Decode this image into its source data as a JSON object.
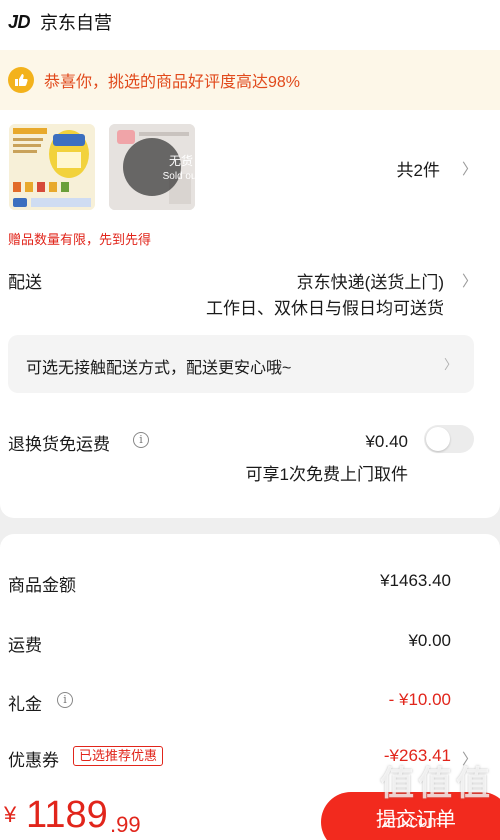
{
  "shop": {
    "logo": "JD",
    "name": "京东自营"
  },
  "banner": {
    "text": "恭喜你，挑选的商品好评度高达98%",
    "icon": "thumbs-up-icon"
  },
  "products": {
    "sold_out_cn": "无货",
    "sold_out_en": "Sold out",
    "count_text": "共2件",
    "gift_note": "赠品数量有限，先到先得"
  },
  "delivery": {
    "label": "配送",
    "method": "京东快递(送货上门)",
    "schedule": "工作日、双休日与假日均可送货",
    "contactless": "可选无接触配送方式，配送更安心哦~"
  },
  "return_shipping": {
    "label": "退换货免运费",
    "price": "¥0.40",
    "note": "可享1次免费上门取件"
  },
  "summary": {
    "goods_label": "商品金额",
    "goods_value": "¥1463.40",
    "freight_label": "运费",
    "freight_value": "¥0.00",
    "gift_money_label": "礼金",
    "gift_money_value": "- ¥10.00",
    "coupon_label": "优惠券",
    "coupon_tag": "已选推荐优惠",
    "coupon_value": "-¥263.41"
  },
  "footer": {
    "currency": "¥",
    "price_int": "1189",
    "price_dec": ".99",
    "submit_label": "提交订单"
  },
  "watermark": {
    "text": "值值值",
    "url": "zhi.com"
  },
  "colors": {
    "accent": "#e1251b",
    "banner_bg": "#fdf7e8",
    "banner_text": "#e14a1c",
    "icon_yellow": "#f3b21c"
  }
}
